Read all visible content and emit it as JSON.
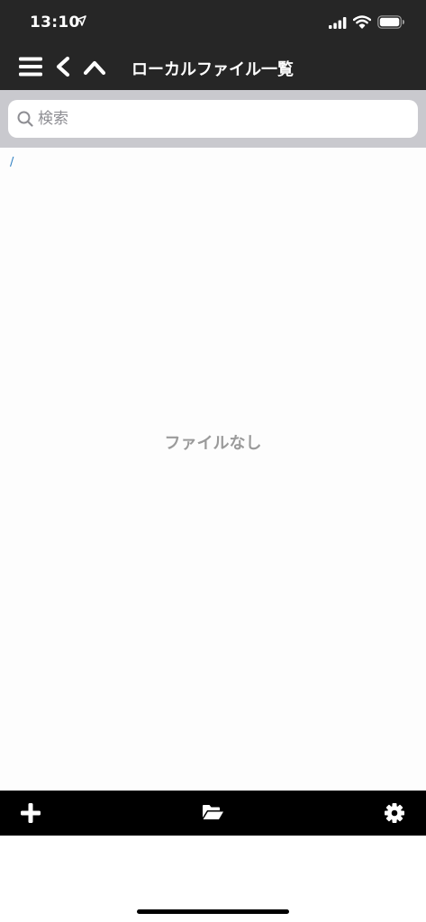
{
  "status_bar": {
    "time": "13:10",
    "icons": [
      "location-icon",
      "signal-icon",
      "wifi-icon",
      "battery-icon"
    ]
  },
  "nav_bar": {
    "title": "ローカルファイル一覧",
    "buttons": [
      "menu-icon",
      "back-chevron-icon",
      "up-chevron-icon"
    ]
  },
  "search": {
    "placeholder": "検索",
    "value": ""
  },
  "content": {
    "path": "/",
    "empty_message": "ファイルなし"
  },
  "toolbar": {
    "buttons": [
      "plus-icon",
      "folder-open-icon",
      "gear-icon"
    ]
  },
  "colors": {
    "bar_background": "#262626",
    "search_area": "#c9c9ce",
    "path_link": "#2e7fc1",
    "empty_text": "#9a9a9a",
    "toolbar_background": "#000000"
  }
}
